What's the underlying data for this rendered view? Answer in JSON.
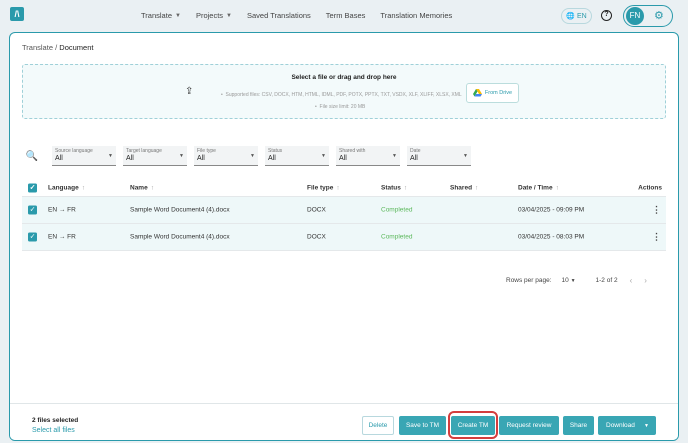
{
  "nav": {
    "logo": "/\\",
    "items": [
      {
        "label": "Translate",
        "dropdown": true
      },
      {
        "label": "Projects",
        "dropdown": true
      },
      {
        "label": "Saved Translations",
        "dropdown": false
      },
      {
        "label": "Term Bases",
        "dropdown": false
      },
      {
        "label": "Translation Memories",
        "dropdown": false
      }
    ],
    "language": "EN",
    "help": "?",
    "avatar_initials": "FN"
  },
  "breadcrumb": {
    "root": "Translate",
    "separator": "/",
    "current": "Document"
  },
  "dropzone": {
    "title": "Select a file or drag and drop here",
    "supported": "Supported files: CSV, DOCX, HTM, HTML, IDML, PDF, POTX, PPTX, TXT, VSDX, XLF, XLIFF, XLSX, XML",
    "size_limit": "File size limit: 20 MB",
    "drive_button": "From Drive"
  },
  "filters": [
    {
      "label": "Source language",
      "value": "All"
    },
    {
      "label": "Target language",
      "value": "All"
    },
    {
      "label": "File type",
      "value": "All"
    },
    {
      "label": "Status",
      "value": "All"
    },
    {
      "label": "Shared with",
      "value": "All"
    },
    {
      "label": "Date",
      "value": "All"
    }
  ],
  "table": {
    "headers": {
      "language": "Language",
      "name": "Name",
      "file_type": "File type",
      "status": "Status",
      "shared": "Shared",
      "date": "Date / Time",
      "actions": "Actions"
    },
    "rows": [
      {
        "source": "EN",
        "target": "FR",
        "name": "Sample Word Document4 (4).docx",
        "file_type": "DOCX",
        "status": "Completed",
        "date": "03/04/2025 - 09:09 PM"
      },
      {
        "source": "EN",
        "target": "FR",
        "name": "Sample Word Document4 (4).docx",
        "file_type": "DOCX",
        "status": "Completed",
        "date": "03/04/2025 - 08:03 PM"
      }
    ]
  },
  "pagination": {
    "rows_per_page_label": "Rows per page:",
    "rows_per_page": "10",
    "range": "1-2 of 2"
  },
  "bottom_bar": {
    "selected_count": "2 files selected",
    "select_all": "Select all files",
    "buttons": {
      "delete": "Delete",
      "save_to_tm": "Save to TM",
      "create_tm": "Create TM",
      "request_review": "Request review",
      "share": "Share",
      "download": "Download"
    }
  },
  "colors": {
    "accent": "#2a9aab",
    "button": "#39a6b4",
    "completed": "#5cb85c",
    "highlight": "#d43d3d"
  }
}
